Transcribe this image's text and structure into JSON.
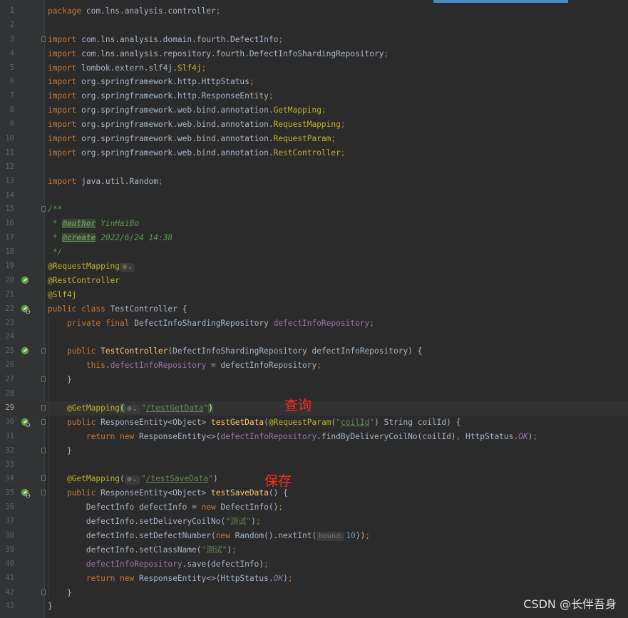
{
  "annotations": {
    "query": "查询",
    "save": "保存"
  },
  "watermark": "CSDN @长伴吾身",
  "lines": [
    {
      "n": "1",
      "t": [
        [
          "kw",
          "package "
        ],
        [
          "",
          "com.lns.analysis.controller"
        ],
        [
          "semi",
          ";"
        ]
      ]
    },
    {
      "n": "2",
      "t": []
    },
    {
      "n": "3",
      "t": [
        [
          "kw",
          "import "
        ],
        [
          "",
          "com.lns.analysis.domain.fourth.DefectInfo"
        ],
        [
          "semi",
          ";"
        ]
      ]
    },
    {
      "n": "4",
      "t": [
        [
          "kw",
          "import "
        ],
        [
          "",
          "com.lns.analysis.repository.fourth.DefectInfoShardingRepository"
        ],
        [
          "semi",
          ";"
        ]
      ]
    },
    {
      "n": "5",
      "t": [
        [
          "kw",
          "import "
        ],
        [
          "",
          "lombok.extern.slf4j."
        ],
        [
          "ann",
          "Slf4j"
        ],
        [
          "semi",
          ";"
        ]
      ]
    },
    {
      "n": "6",
      "t": [
        [
          "kw",
          "import "
        ],
        [
          "",
          "org.springframework.http.HttpStatus"
        ],
        [
          "semi",
          ";"
        ]
      ]
    },
    {
      "n": "7",
      "t": [
        [
          "kw",
          "import "
        ],
        [
          "",
          "org.springframework.http.ResponseEntity"
        ],
        [
          "semi",
          ";"
        ]
      ]
    },
    {
      "n": "8",
      "t": [
        [
          "kw",
          "import "
        ],
        [
          "",
          "org.springframework.web.bind.annotation."
        ],
        [
          "ann",
          "GetMapping"
        ],
        [
          "semi",
          ";"
        ]
      ]
    },
    {
      "n": "9",
      "t": [
        [
          "kw",
          "import "
        ],
        [
          "",
          "org.springframework.web.bind.annotation."
        ],
        [
          "ann",
          "RequestMapping"
        ],
        [
          "semi",
          ";"
        ]
      ]
    },
    {
      "n": "10",
      "t": [
        [
          "kw",
          "import "
        ],
        [
          "",
          "org.springframework.web.bind.annotation."
        ],
        [
          "ann",
          "RequestParam"
        ],
        [
          "semi",
          ";"
        ]
      ]
    },
    {
      "n": "11",
      "t": [
        [
          "kw",
          "import "
        ],
        [
          "",
          "org.springframework.web.bind.annotation."
        ],
        [
          "ann",
          "RestController"
        ],
        [
          "semi",
          ";"
        ]
      ]
    },
    {
      "n": "12",
      "t": []
    },
    {
      "n": "13",
      "t": [
        [
          "kw",
          "import "
        ],
        [
          "",
          "java.util.Random"
        ],
        [
          "semi",
          ";"
        ]
      ]
    },
    {
      "n": "14",
      "t": []
    },
    {
      "n": "15",
      "t": [
        [
          "doc",
          "/**"
        ]
      ]
    },
    {
      "n": "16",
      "t": [
        [
          "doc",
          " * "
        ],
        [
          "doctag",
          "@author"
        ],
        [
          "doc",
          " YinHaiBo"
        ]
      ]
    },
    {
      "n": "17",
      "t": [
        [
          "doc",
          " * "
        ],
        [
          "doctag",
          "@create"
        ],
        [
          "doc",
          " 2022/6/24 14:38"
        ]
      ]
    },
    {
      "n": "18",
      "t": [
        [
          "doc",
          " */"
        ]
      ]
    },
    {
      "n": "19",
      "t": [
        [
          "ann",
          "@RequestMapping"
        ],
        [
          "inlay",
          "⊕⌄"
        ]
      ]
    },
    {
      "n": "20",
      "t": [
        [
          "ann",
          "@RestController"
        ]
      ]
    },
    {
      "n": "21",
      "t": [
        [
          "ann",
          "@Slf4j"
        ]
      ]
    },
    {
      "n": "22",
      "t": [
        [
          "kw",
          "public class "
        ],
        [
          "",
          "TestController {"
        ]
      ]
    },
    {
      "n": "23",
      "t": [
        [
          "",
          "    "
        ],
        [
          "kw",
          "private final "
        ],
        [
          "",
          "DefectInfoShardingRepository "
        ],
        [
          "field",
          "defectInfoRepository"
        ],
        [
          "semi",
          ";"
        ]
      ]
    },
    {
      "n": "24",
      "t": []
    },
    {
      "n": "25",
      "t": [
        [
          "",
          "    "
        ],
        [
          "kw",
          "public "
        ],
        [
          "fn",
          "TestController"
        ],
        [
          "",
          "(DefectInfoShardingRepository defectInfoRepository) {"
        ]
      ]
    },
    {
      "n": "26",
      "t": [
        [
          "",
          "        "
        ],
        [
          "kw",
          "this"
        ],
        [
          "",
          "."
        ],
        [
          "field",
          "defectInfoRepository"
        ],
        [
          "",
          " = defectInfoRepository"
        ],
        [
          "semi",
          ";"
        ]
      ]
    },
    {
      "n": "27",
      "t": [
        [
          "",
          "    }"
        ]
      ]
    },
    {
      "n": "28",
      "t": []
    },
    {
      "n": "29",
      "t": [
        [
          "",
          "    "
        ],
        [
          "ann",
          "@GetMapping"
        ],
        [
          "brace",
          "("
        ],
        [
          "inlay",
          "⊕⌄"
        ],
        [
          "str",
          "\""
        ],
        [
          "link",
          "/testGetData"
        ],
        [
          "str",
          "\""
        ],
        [
          "brace",
          ")"
        ]
      ],
      "current": true
    },
    {
      "n": "30",
      "t": [
        [
          "",
          "    "
        ],
        [
          "kw",
          "public "
        ],
        [
          "",
          "ResponseEntity<Object> "
        ],
        [
          "fn",
          "testGetData"
        ],
        [
          "",
          "("
        ],
        [
          "ann",
          "@RequestParam"
        ],
        [
          "",
          "("
        ],
        [
          "str",
          "\""
        ],
        [
          "link",
          "coilId"
        ],
        [
          "str",
          "\""
        ],
        [
          "",
          ") String coilId) {"
        ]
      ]
    },
    {
      "n": "31",
      "t": [
        [
          "",
          "        "
        ],
        [
          "kw",
          "return new "
        ],
        [
          "",
          "ResponseEntity<>("
        ],
        [
          "field",
          "defectInfoRepository"
        ],
        [
          "",
          ".findByDeliveryCoilNo(coilId)"
        ],
        [
          "semi",
          ", "
        ],
        [
          "",
          "HttpStatus."
        ],
        [
          "field italic",
          "OK"
        ],
        [
          "",
          ")"
        ],
        [
          "semi",
          ";"
        ]
      ]
    },
    {
      "n": "32",
      "t": [
        [
          "",
          "    }"
        ]
      ]
    },
    {
      "n": "33",
      "t": []
    },
    {
      "n": "34",
      "t": [
        [
          "",
          "    "
        ],
        [
          "ann",
          "@GetMapping"
        ],
        [
          "",
          "("
        ],
        [
          "inlay",
          "⊕⌄"
        ],
        [
          "str",
          "\""
        ],
        [
          "link",
          "/testSaveData"
        ],
        [
          "str",
          "\""
        ],
        [
          "",
          ")"
        ]
      ]
    },
    {
      "n": "35",
      "t": [
        [
          "",
          "    "
        ],
        [
          "kw",
          "public "
        ],
        [
          "",
          "ResponseEntity<Object> "
        ],
        [
          "fn",
          "testSaveData"
        ],
        [
          "",
          "() {"
        ]
      ]
    },
    {
      "n": "36",
      "t": [
        [
          "",
          "        DefectInfo defectInfo = "
        ],
        [
          "kw",
          "new "
        ],
        [
          "",
          "DefectInfo()"
        ],
        [
          "semi",
          ";"
        ]
      ]
    },
    {
      "n": "37",
      "t": [
        [
          "",
          "        defectInfo.setDeliveryCoilNo("
        ],
        [
          "str",
          "\"测试\""
        ],
        [
          "",
          ")"
        ],
        [
          "semi",
          ";"
        ]
      ]
    },
    {
      "n": "38",
      "t": [
        [
          "",
          "        defectInfo.setDefectNumber("
        ],
        [
          "kw",
          "new "
        ],
        [
          "",
          "Random().nextInt("
        ],
        [
          "hint",
          "bound:"
        ],
        [
          "num",
          "10"
        ],
        [
          "",
          "))"
        ],
        [
          "semi",
          ";"
        ]
      ]
    },
    {
      "n": "39",
      "t": [
        [
          "",
          "        defectInfo.setClassName("
        ],
        [
          "str",
          "\"测试\""
        ],
        [
          "",
          ")"
        ],
        [
          "semi",
          ";"
        ]
      ]
    },
    {
      "n": "40",
      "t": [
        [
          "",
          "        "
        ],
        [
          "field",
          "defectInfoRepository"
        ],
        [
          "",
          ".save(defectInfo)"
        ],
        [
          "semi",
          ";"
        ]
      ]
    },
    {
      "n": "41",
      "t": [
        [
          "",
          "        "
        ],
        [
          "kw",
          "return new "
        ],
        [
          "",
          "ResponseEntity<>(HttpStatus."
        ],
        [
          "field italic",
          "OK"
        ],
        [
          "",
          ")"
        ],
        [
          "semi",
          ";"
        ]
      ]
    },
    {
      "n": "42",
      "t": [
        [
          "",
          "    }"
        ]
      ]
    },
    {
      "n": "43",
      "t": [
        [
          "",
          "}"
        ]
      ]
    }
  ],
  "gutter_icons": {
    "20": "spring-bean-icon",
    "22": "spring-bean-web-icon",
    "25": "spring-bean-icon",
    "30": "spring-web-endpoint-icon",
    "35": "spring-web-endpoint-icon"
  },
  "fold_lines": [
    "3",
    "15",
    "25",
    "27",
    "29",
    "30",
    "32",
    "34",
    "35",
    "42"
  ],
  "colors": {
    "background": "#2b2b2b",
    "keyword": "#cc7832",
    "string": "#6a8759",
    "annotation": "#bbb529",
    "field": "#9876aa",
    "method": "#ffc66d",
    "number": "#6897bb",
    "note": "#ff2a1a"
  }
}
